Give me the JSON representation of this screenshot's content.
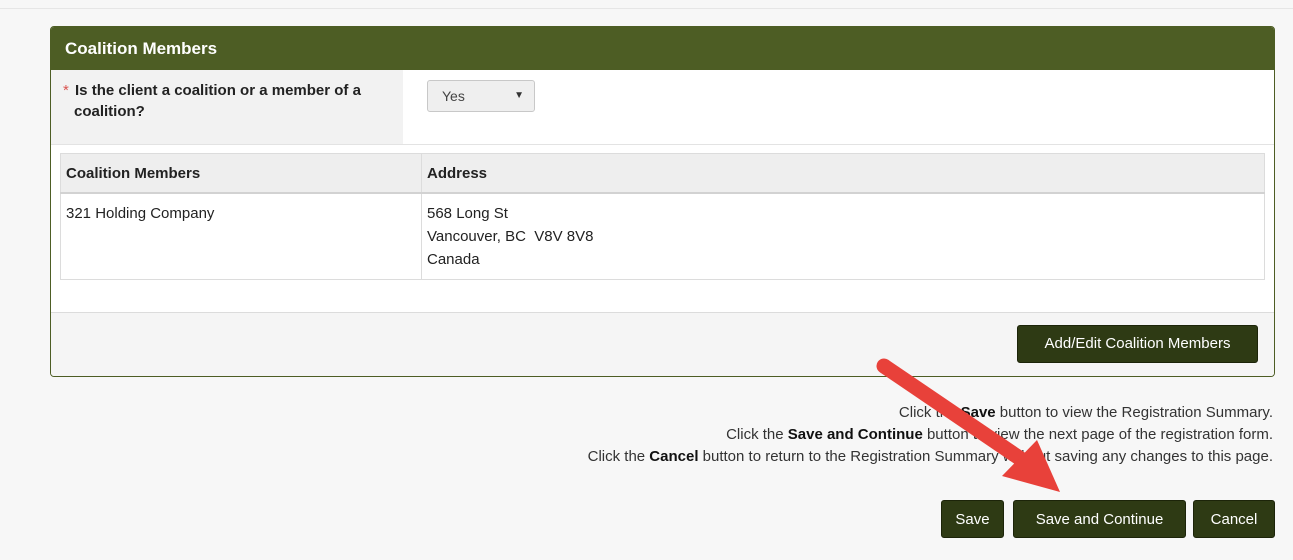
{
  "panel": {
    "title": "Coalition Members",
    "question": {
      "required_marker": "*",
      "label_line1": "Is the client a coalition or a member of a",
      "label_line2": "coalition?",
      "selected_value": "Yes"
    },
    "table": {
      "headers": [
        "Coalition Members",
        "Address"
      ],
      "rows": [
        {
          "member": "321 Holding Company",
          "address_line1": "568 Long St",
          "address_line2": "Vancouver, BC  V8V 8V8",
          "address_line3": "Canada"
        }
      ]
    },
    "add_edit_label": "Add/Edit Coalition Members"
  },
  "instructions": {
    "line1": {
      "pre": "Click the ",
      "bold": "Save",
      "post": " button to view the Registration Summary."
    },
    "line2": {
      "pre": "Click the ",
      "bold": "Save and Continue",
      "post": " button to view the next page of the registration form."
    },
    "line3": {
      "pre": "Click the ",
      "bold": "Cancel",
      "post": " button to return to the Registration Summary without saving any changes to this page."
    }
  },
  "actions": {
    "save": "Save",
    "save_continue": "Save and Continue",
    "cancel": "Cancel"
  },
  "colors": {
    "header_green": "#4d5d24",
    "button_dark": "#2e3a14",
    "annotation_arrow": "#e8413a",
    "required_red": "#d9534f"
  },
  "icons": {
    "select_arrow": "chevron-down-icon",
    "annotation": "red-arrow-annotation"
  }
}
